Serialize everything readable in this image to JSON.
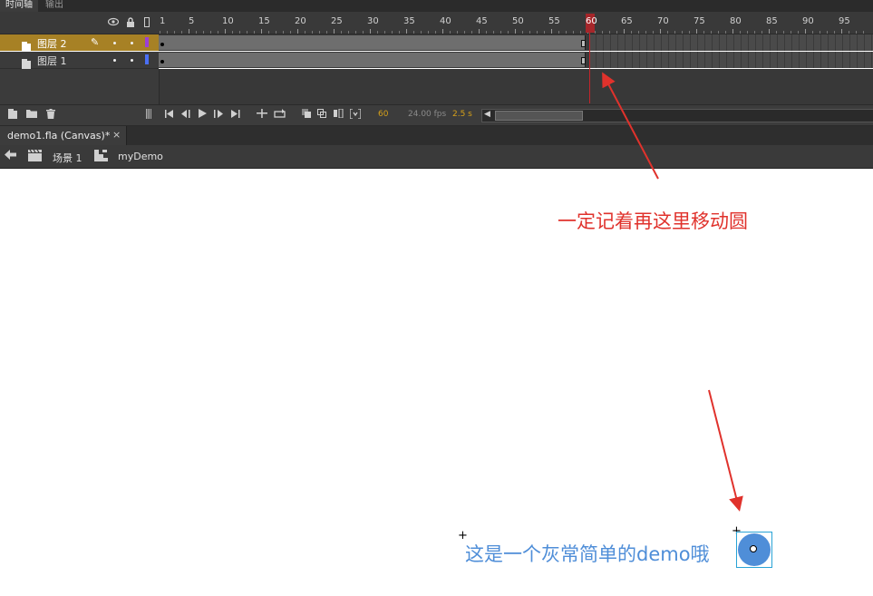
{
  "panel_tabs": [
    {
      "label": "时间轴",
      "active": true
    },
    {
      "label": "输出",
      "active": false
    }
  ],
  "ruler": {
    "numbers": [
      "1",
      "5",
      "10",
      "15",
      "20",
      "25",
      "30",
      "35",
      "40",
      "45",
      "50",
      "55",
      "60",
      "65",
      "70",
      "75",
      "80",
      "85",
      "90",
      "95"
    ],
    "current_frame": "60"
  },
  "header_icons": [
    "eye-icon",
    "lock-icon",
    "outline-icon"
  ],
  "layers": [
    {
      "name": "图层 2",
      "selected": true,
      "tag_color": "#9b3fd6",
      "icon": "layer-icon"
    },
    {
      "name": "图层 1",
      "selected": false,
      "tag_color": "#4a6ff5",
      "icon": "layer-icon"
    }
  ],
  "controls": {
    "frame": "60",
    "fps": "24.00 fps",
    "time": "2.5 s",
    "frame_color": "#d6a019",
    "fps_color": "#8a8a8a",
    "time_color": "#d6a019"
  },
  "doc_tab": {
    "label": "demo1.fla (Canvas)*",
    "close": "×"
  },
  "edit_bar": {
    "scene": "场景 1",
    "symbol": "myDemo"
  },
  "stage": {
    "note": "一定记着再这里移动圆",
    "note_color": "#e0322c",
    "text": "这是一个灰常简单的demo哦",
    "text_color": "#4f8ed8",
    "circle_color": "#4f8ed8"
  }
}
